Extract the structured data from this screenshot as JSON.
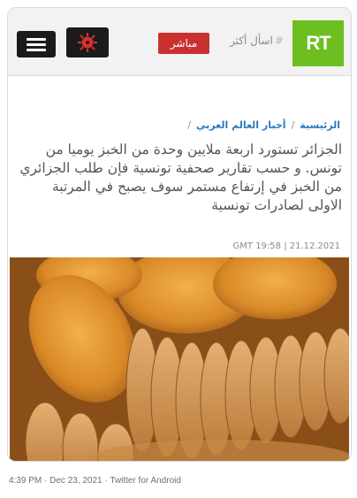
{
  "header": {
    "live_label": "مباشر",
    "ask_more_label": "اسأل أكثر",
    "ask_more_hash": "#",
    "logo_text": "RT",
    "menu_icon": "hamburger-menu-icon",
    "virus_icon": "coronavirus-icon",
    "colors": {
      "live": "#c9312f",
      "logo": "#6cbf1f",
      "dark": "#1b1b1b"
    }
  },
  "article": {
    "breadcrumb": [
      "الرئيسية",
      "أخبار العالم العربي"
    ],
    "breadcrumb_separator": "/",
    "headline": "الجزائر تستورد اربعة ملايين وحدة من الخبز يوميا من تونس. و حسب تقارير صحفية تونسية فإن طلب الجزائري من الخبز في إرتفاع مستمر سوف يصبح في المرتبة الاولى لصادرات تونسية",
    "dateline": "GMT 19:58 | 21.12.2021",
    "image_alt": "stacked-round-bread-loaves"
  },
  "tweet": {
    "meta": "4:39 PM · Dec 23, 2021 · Twitter for Android"
  }
}
